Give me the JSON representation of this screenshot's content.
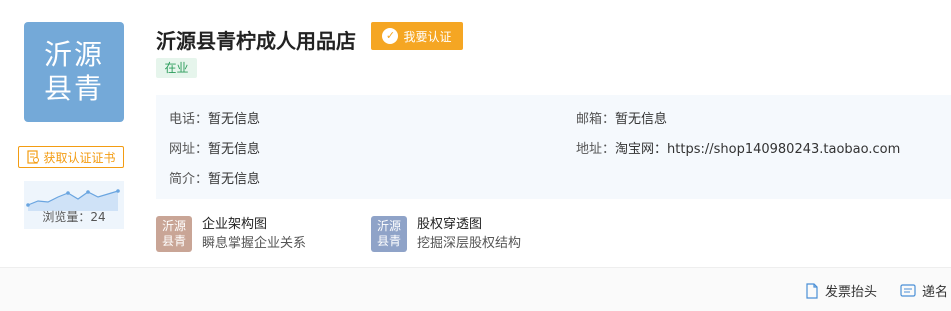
{
  "logo": {
    "line1": "沂源",
    "line2": "县青"
  },
  "cert_button": {
    "label": "获取认证证书"
  },
  "views": {
    "label": "浏览量：",
    "count": "24"
  },
  "company": {
    "name": "沂源县青柠成人用品店",
    "status": "在业"
  },
  "verify_badge": {
    "label": "我要认证"
  },
  "info": {
    "phone_label": "电话：",
    "phone": "暂无信息",
    "email_label": "邮箱：",
    "email": "暂无信息",
    "website_label": "网址：",
    "website": "暂无信息",
    "address_label": "地址：",
    "address": "淘宝网：https://shop140980243.taobao.com",
    "intro_label": "简介：",
    "intro": "暂无信息"
  },
  "links": [
    {
      "logo1": "沂源",
      "logo2": "县青",
      "title": "企业架构图",
      "subtitle": "瞬息掌握企业关系",
      "color": "#c9a596"
    },
    {
      "logo1": "沂源",
      "logo2": "县青",
      "title": "股权穿透图",
      "subtitle": "挖掘深层股权结构",
      "color": "#8fa3c8"
    }
  ],
  "bottom": {
    "invoice": "发票抬头",
    "card": "递名"
  },
  "colors": {
    "accent": "#f5a623",
    "logo_bg": "#74a9d8",
    "status_green": "#2d9d5c"
  }
}
